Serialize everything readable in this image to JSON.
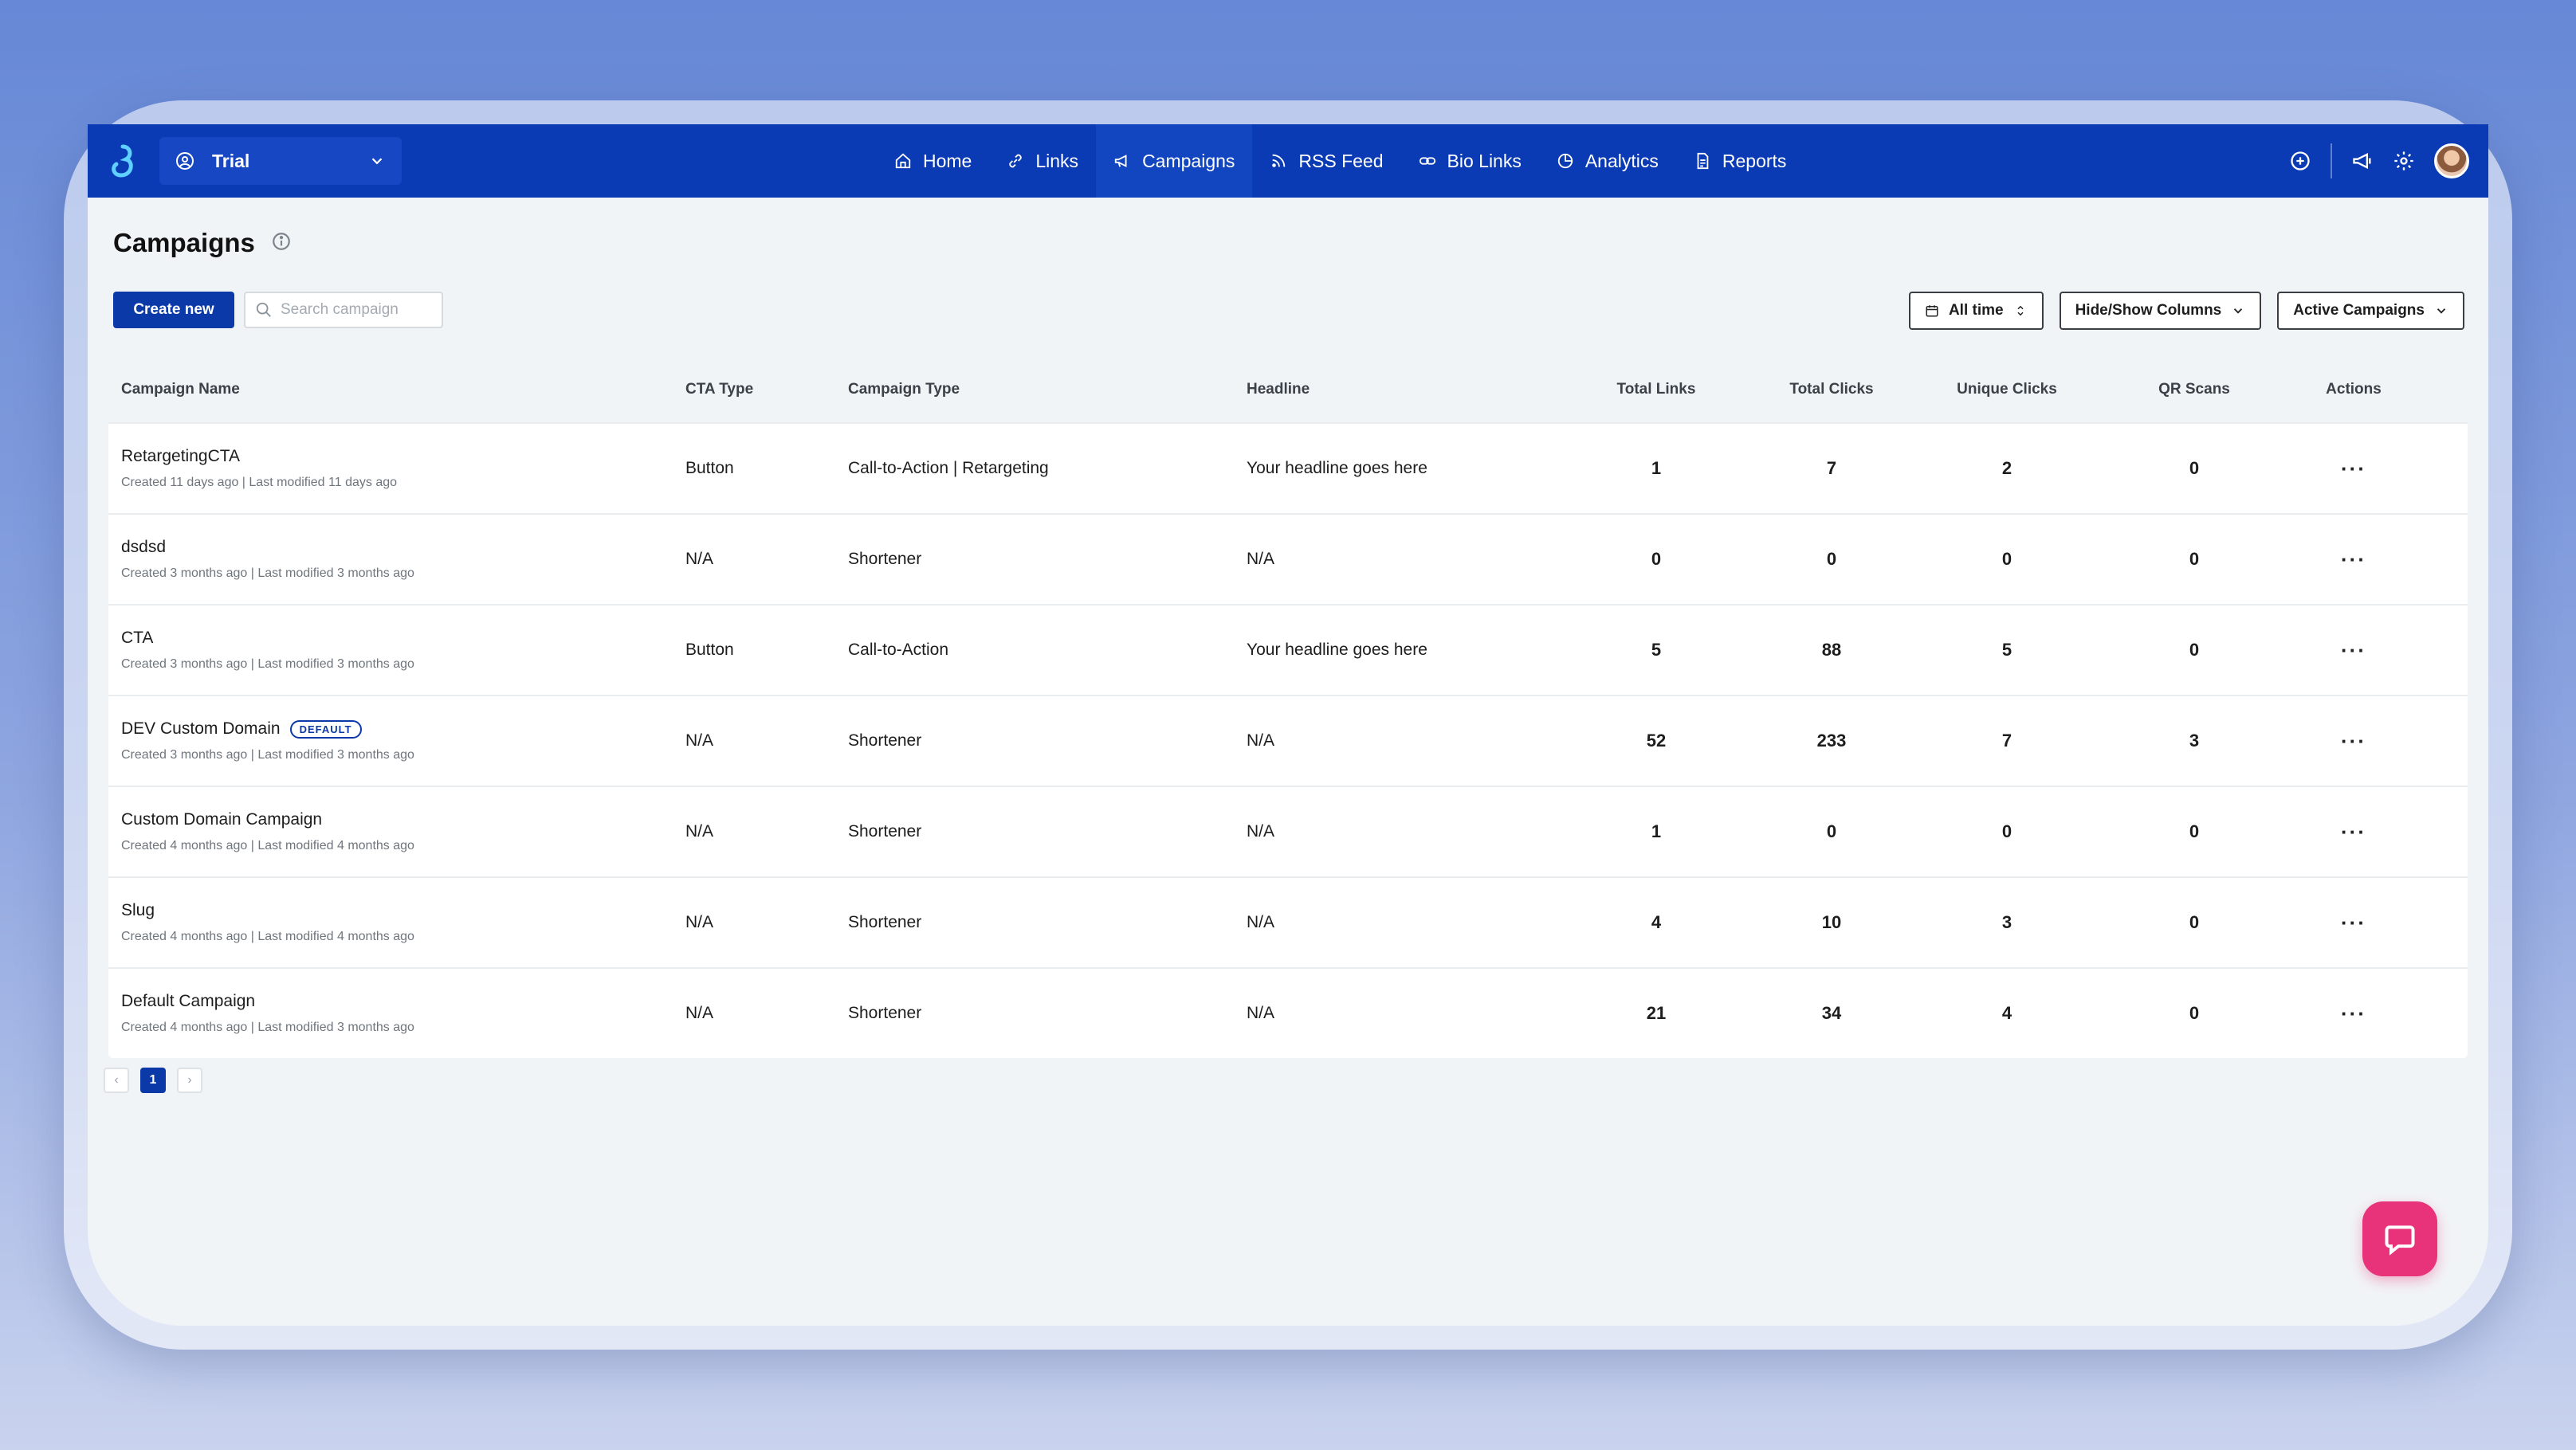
{
  "workspace": {
    "name": "Trial"
  },
  "nav": [
    {
      "label": "Home",
      "icon": "home-icon"
    },
    {
      "label": "Links",
      "icon": "link-icon"
    },
    {
      "label": "Campaigns",
      "icon": "megaphone-icon",
      "active": true
    },
    {
      "label": "RSS Feed",
      "icon": "rss-icon"
    },
    {
      "label": "Bio Links",
      "icon": "bio-link-icon"
    },
    {
      "label": "Analytics",
      "icon": "analytics-icon"
    },
    {
      "label": "Reports",
      "icon": "report-icon"
    }
  ],
  "page": {
    "title": "Campaigns"
  },
  "toolbar": {
    "create_label": "Create new",
    "search_placeholder": "Search campaign",
    "date_filter": "All time",
    "columns_filter": "Hide/Show Columns",
    "status_filter": "Active Campaigns"
  },
  "table": {
    "headers": {
      "name": "Campaign Name",
      "cta": "CTA Type",
      "type": "Campaign Type",
      "headline": "Headline",
      "links": "Total Links",
      "clicks": "Total Clicks",
      "unique": "Unique Clicks",
      "qr": "QR Scans",
      "actions": "Actions"
    },
    "rows": [
      {
        "name": "RetargetingCTA",
        "meta": "Created 11 days ago | Last modified 11 days ago",
        "cta": "Button",
        "type": "Call-to-Action | Retargeting",
        "headline": "Your headline goes here",
        "links": "1",
        "clicks": "7",
        "unique": "2",
        "qr": "0"
      },
      {
        "name": "dsdsd",
        "meta": "Created 3 months ago | Last modified 3 months ago",
        "cta": "N/A",
        "type": "Shortener",
        "headline": "N/A",
        "links": "0",
        "clicks": "0",
        "unique": "0",
        "qr": "0"
      },
      {
        "name": "CTA",
        "meta": "Created 3 months ago | Last modified 3 months ago",
        "cta": "Button",
        "type": "Call-to-Action",
        "headline": "Your headline goes here",
        "links": "5",
        "clicks": "88",
        "unique": "5",
        "qr": "0"
      },
      {
        "name": "DEV Custom Domain",
        "badge": "DEFAULT",
        "meta": "Created 3 months ago | Last modified 3 months ago",
        "cta": "N/A",
        "type": "Shortener",
        "headline": "N/A",
        "links": "52",
        "clicks": "233",
        "unique": "7",
        "qr": "3"
      },
      {
        "name": "Custom Domain Campaign",
        "meta": "Created 4 months ago | Last modified 4 months ago",
        "cta": "N/A",
        "type": "Shortener",
        "headline": "N/A",
        "links": "1",
        "clicks": "0",
        "unique": "0",
        "qr": "0"
      },
      {
        "name": "Slug",
        "meta": "Created 4 months ago | Last modified 4 months ago",
        "cta": "N/A",
        "type": "Shortener",
        "headline": "N/A",
        "links": "4",
        "clicks": "10",
        "unique": "3",
        "qr": "0"
      },
      {
        "name": "Default Campaign",
        "meta": "Created 4 months ago | Last modified 3 months ago",
        "cta": "N/A",
        "type": "Shortener",
        "headline": "N/A",
        "links": "21",
        "clicks": "34",
        "unique": "4",
        "qr": "0"
      }
    ]
  },
  "pagination": {
    "prev": "‹",
    "current": "1",
    "next": "›"
  },
  "colors": {
    "brand": "#0a3bb5",
    "accent": "#e8337a",
    "background": "#f1f4f6"
  }
}
